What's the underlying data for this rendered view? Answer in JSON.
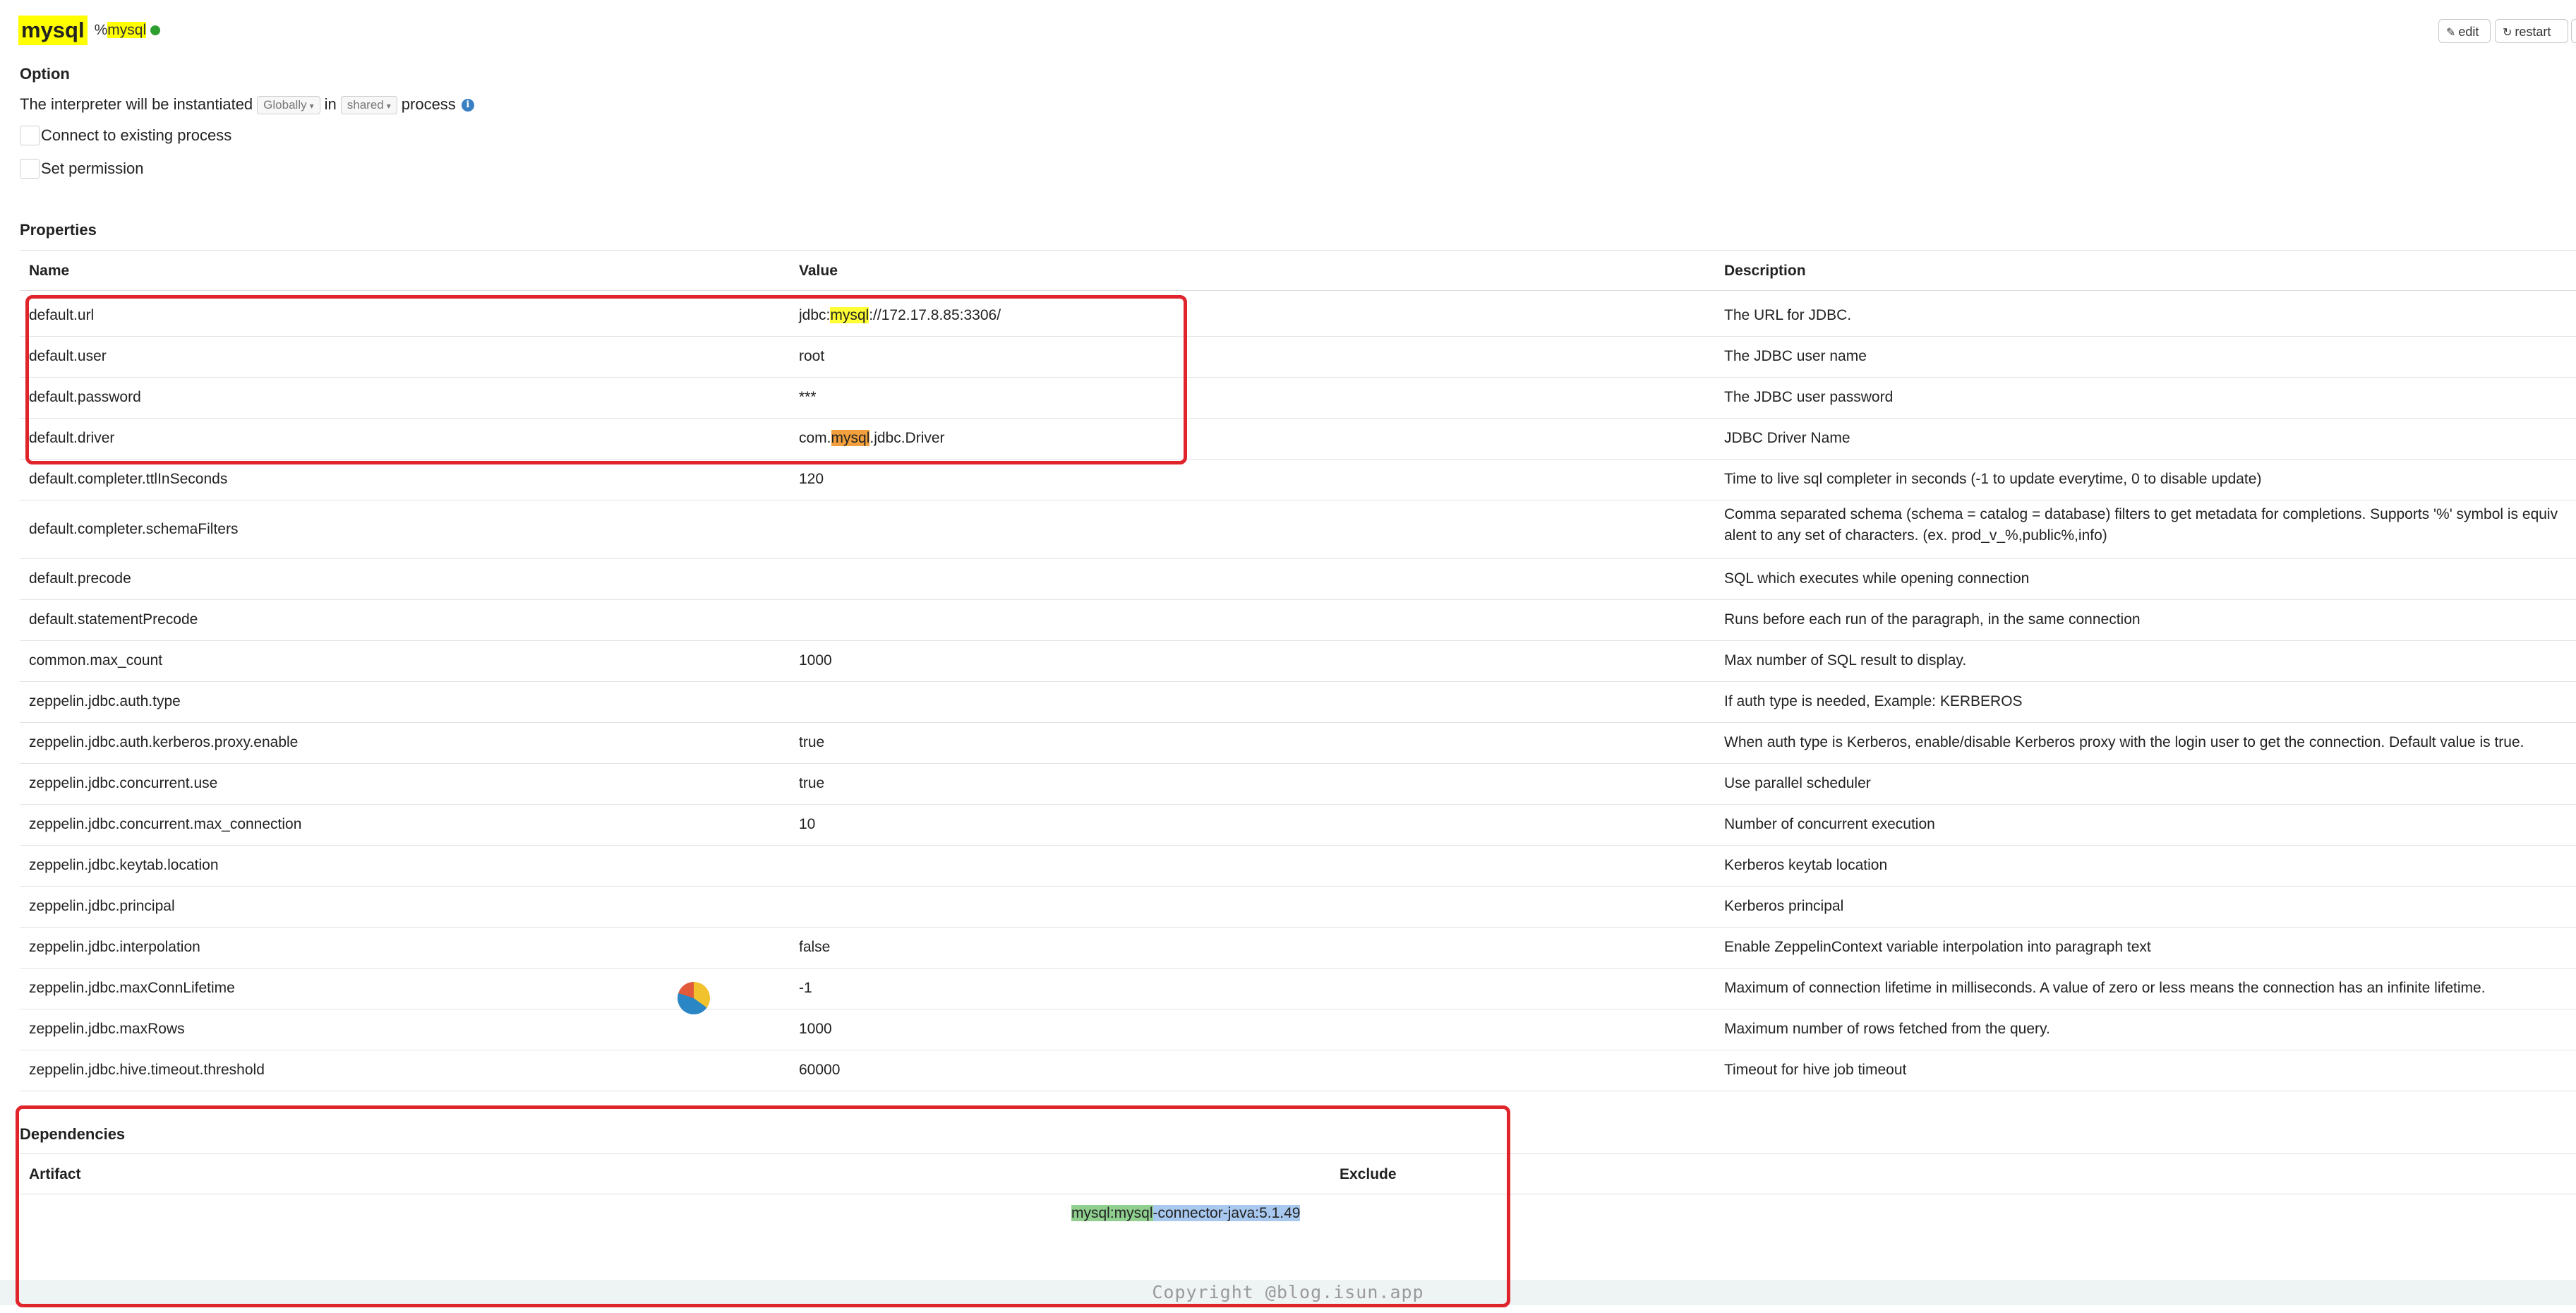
{
  "header": {
    "title": "mysql",
    "group_prefix": "%",
    "group_name": "mysql",
    "status_color": "#2e9e2e",
    "edit_label": "edit",
    "restart_label": "restart"
  },
  "option": {
    "heading": "Option",
    "text_before": "The interpreter will be instantiated",
    "scope_select": "Globally",
    "text_middle": "in",
    "process_select": "shared",
    "text_after": "process",
    "connect_existing_label": "Connect to existing process",
    "set_permission_label": "Set permission"
  },
  "properties": {
    "heading": "Properties",
    "columns": {
      "name": "Name",
      "value": "Value",
      "description": "Description"
    },
    "rows": [
      {
        "name": "default.url",
        "value_parts": [
          "jdbc:",
          "mysql",
          "://172.17.8.85:3306/"
        ],
        "description": "The URL for JDBC."
      },
      {
        "name": "default.user",
        "value": "root",
        "description": "The JDBC user name"
      },
      {
        "name": "default.password",
        "value": "***",
        "description": "The JDBC user password"
      },
      {
        "name": "default.driver",
        "value_parts": [
          "com.",
          "mysql",
          ".jdbc.Driver"
        ],
        "description": "JDBC Driver Name"
      },
      {
        "name": "default.completer.ttlInSeconds",
        "value": "120",
        "description": "Time to live sql completer in seconds (-1 to update everytime, 0 to disable update)"
      },
      {
        "name": "default.completer.schemaFilters",
        "value": "",
        "description_line1": "Comma separated schema (schema = catalog = database) filters to get metadata for completions. Supports '%' symbol is equiv",
        "description_line2": "alent to any set of characters. (ex. prod_v_%,public%,info)"
      },
      {
        "name": "default.precode",
        "value": "",
        "description": "SQL which executes while opening connection"
      },
      {
        "name": "default.statementPrecode",
        "value": "",
        "description": "Runs before each run of the paragraph, in the same connection"
      },
      {
        "name": "common.max_count",
        "value": "1000",
        "description": "Max number of SQL result to display."
      },
      {
        "name": "zeppelin.jdbc.auth.type",
        "value": "",
        "description": "If auth type is needed, Example: KERBEROS"
      },
      {
        "name": "zeppelin.jdbc.auth.kerberos.proxy.enable",
        "value": "true",
        "description": "When auth type is Kerberos, enable/disable Kerberos proxy with the login user to get the connection. Default value is true."
      },
      {
        "name": "zeppelin.jdbc.concurrent.use",
        "value": "true",
        "description": "Use parallel scheduler"
      },
      {
        "name": "zeppelin.jdbc.concurrent.max_connection",
        "value": "10",
        "description": "Number of concurrent execution"
      },
      {
        "name": "zeppelin.jdbc.keytab.location",
        "value": "",
        "description": "Kerberos keytab location"
      },
      {
        "name": "zeppelin.jdbc.principal",
        "value": "",
        "description": "Kerberos principal"
      },
      {
        "name": "zeppelin.jdbc.interpolation",
        "value": "false",
        "description": "Enable ZeppelinContext variable interpolation into paragraph text"
      },
      {
        "name": "zeppelin.jdbc.maxConnLifetime",
        "value": "-1",
        "description": "Maximum of connection lifetime in milliseconds. A value of zero or less means the connection has an infinite lifetime."
      },
      {
        "name": "zeppelin.jdbc.maxRows",
        "value": "1000",
        "description": "Maximum number of rows fetched from the query."
      },
      {
        "name": "zeppelin.jdbc.hive.timeout.threshold",
        "value": "60000",
        "description": "Timeout for hive job timeout"
      }
    ]
  },
  "dependencies": {
    "heading": "Dependencies",
    "columns": {
      "artifact": "Artifact",
      "exclude": "Exclude"
    },
    "artifact_parts": [
      "mysql:mysql",
      "-connector-java:5.1.49"
    ]
  },
  "footer": {
    "copyright": "Copyright @blog.isun.app"
  },
  "colors": {
    "highlight_yellow": "#ffff33",
    "highlight_orange": "#f2a03d",
    "annotation_red": "#e0242b"
  }
}
